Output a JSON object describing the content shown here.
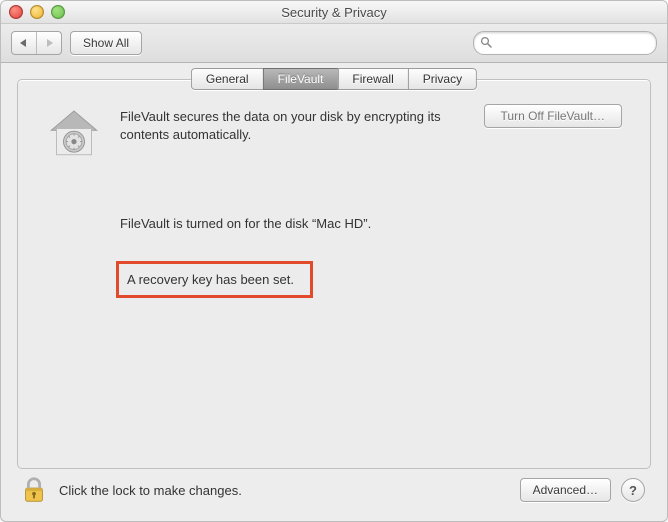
{
  "window": {
    "title": "Security & Privacy"
  },
  "toolbar": {
    "show_all_label": "Show All",
    "search_placeholder": ""
  },
  "tabs": {
    "general": "General",
    "filevault": "FileVault",
    "firewall": "Firewall",
    "privacy": "Privacy",
    "active": "filevault"
  },
  "filevault": {
    "description": "FileVault secures the data on your disk by encrypting its contents automatically.",
    "turn_off_label": "Turn Off FileVault…",
    "status_on": "FileVault is turned on for the disk “Mac HD”.",
    "recovery_msg": "A recovery key has been set."
  },
  "footer": {
    "lock_text": "Click the lock to make changes.",
    "advanced_label": "Advanced…"
  }
}
